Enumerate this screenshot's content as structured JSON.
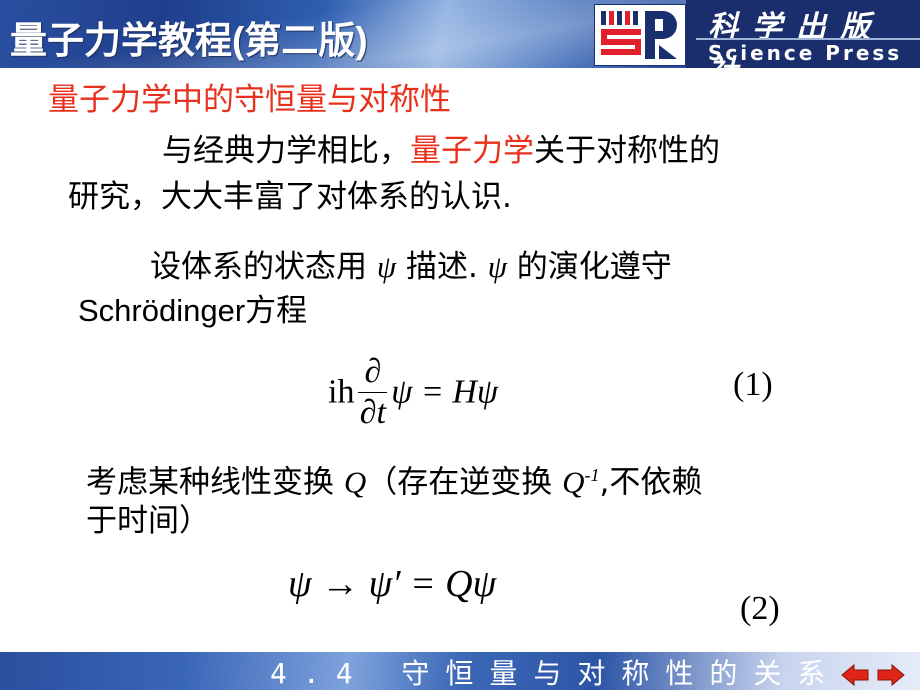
{
  "header": {
    "app_title": "量子力学教程(第二版)",
    "publisher_cn": "科学出版社",
    "publisher_en": "Science Press",
    "colors": {
      "band": "#1e3f8c",
      "logo_red": "#e0202a",
      "logo_blue": "#1a2f70"
    }
  },
  "slide": {
    "section_title": "量子力学中的守恒量与对称性",
    "para1": {
      "line1_pre": "与经典力学相比，",
      "line1_red": "量子力学",
      "line1_post": "关于对称性的",
      "line2": "研究，大大丰富了对体系的认识."
    },
    "para2": {
      "line1_a": "设体系的状态用 ",
      "psi": "ψ",
      "line1_b": " 描述. ",
      "line1_c": " 的演化遵守",
      "line2": "Schrödinger方程"
    },
    "equation1": {
      "prefix": "ih",
      "num": "∂",
      "den": "∂t",
      "rhs": "ψ = Hψ",
      "label": "(1)"
    },
    "para3": {
      "line1_a": "考虑某种线性变换 ",
      "Q": "Q",
      "line1_b": "（存在逆变换 ",
      "Qinv": "Q",
      "sup": "-1",
      "line1_c": ",不依赖",
      "line2": "于时间）"
    },
    "equation2": {
      "text": "ψ → ψ′ = Qψ",
      "label": "(2)"
    },
    "accent_color": "#e8301c"
  },
  "footer": {
    "section": "4.4  守恒量与对称性的关系",
    "prev_icon": "arrow-left-icon",
    "next_icon": "arrow-right-icon"
  }
}
